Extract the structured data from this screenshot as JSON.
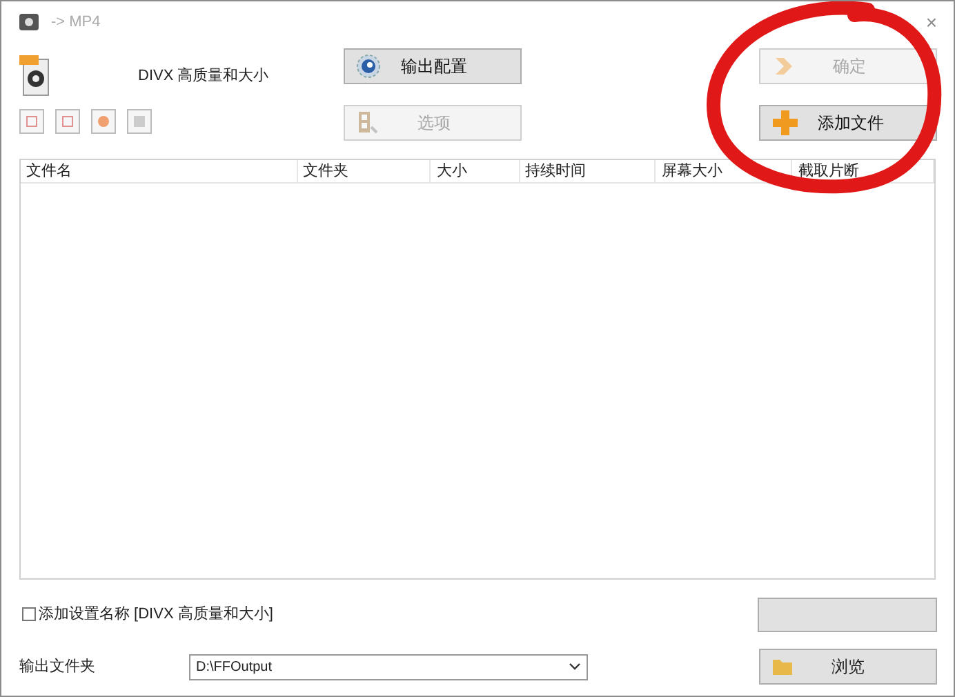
{
  "window": {
    "title": "-> MP4",
    "close": "×"
  },
  "profile": {
    "name": "DIVX 高质量和大小"
  },
  "buttons": [
    {
      "label": "输出配置",
      "kind": "config",
      "disabled": false,
      "pressed": true
    },
    {
      "label": "选项",
      "kind": "options",
      "disabled": true,
      "pressed": false
    },
    {
      "label": "确定",
      "kind": "ok",
      "disabled": true,
      "pressed": false
    },
    {
      "label": "添加文件",
      "kind": "add",
      "disabled": false,
      "pressed": true
    }
  ],
  "table": {
    "columns": [
      "文件名",
      "文件夹",
      "大小",
      "持续时间",
      "屏幕大小",
      "截取片断"
    ]
  },
  "add_name": {
    "label": "添加设置名称 [DIVX 高质量和大小]",
    "checked": false
  },
  "output": {
    "label": "输出文件夹",
    "value": "D:\\FFOutput",
    "browse": "浏览"
  }
}
